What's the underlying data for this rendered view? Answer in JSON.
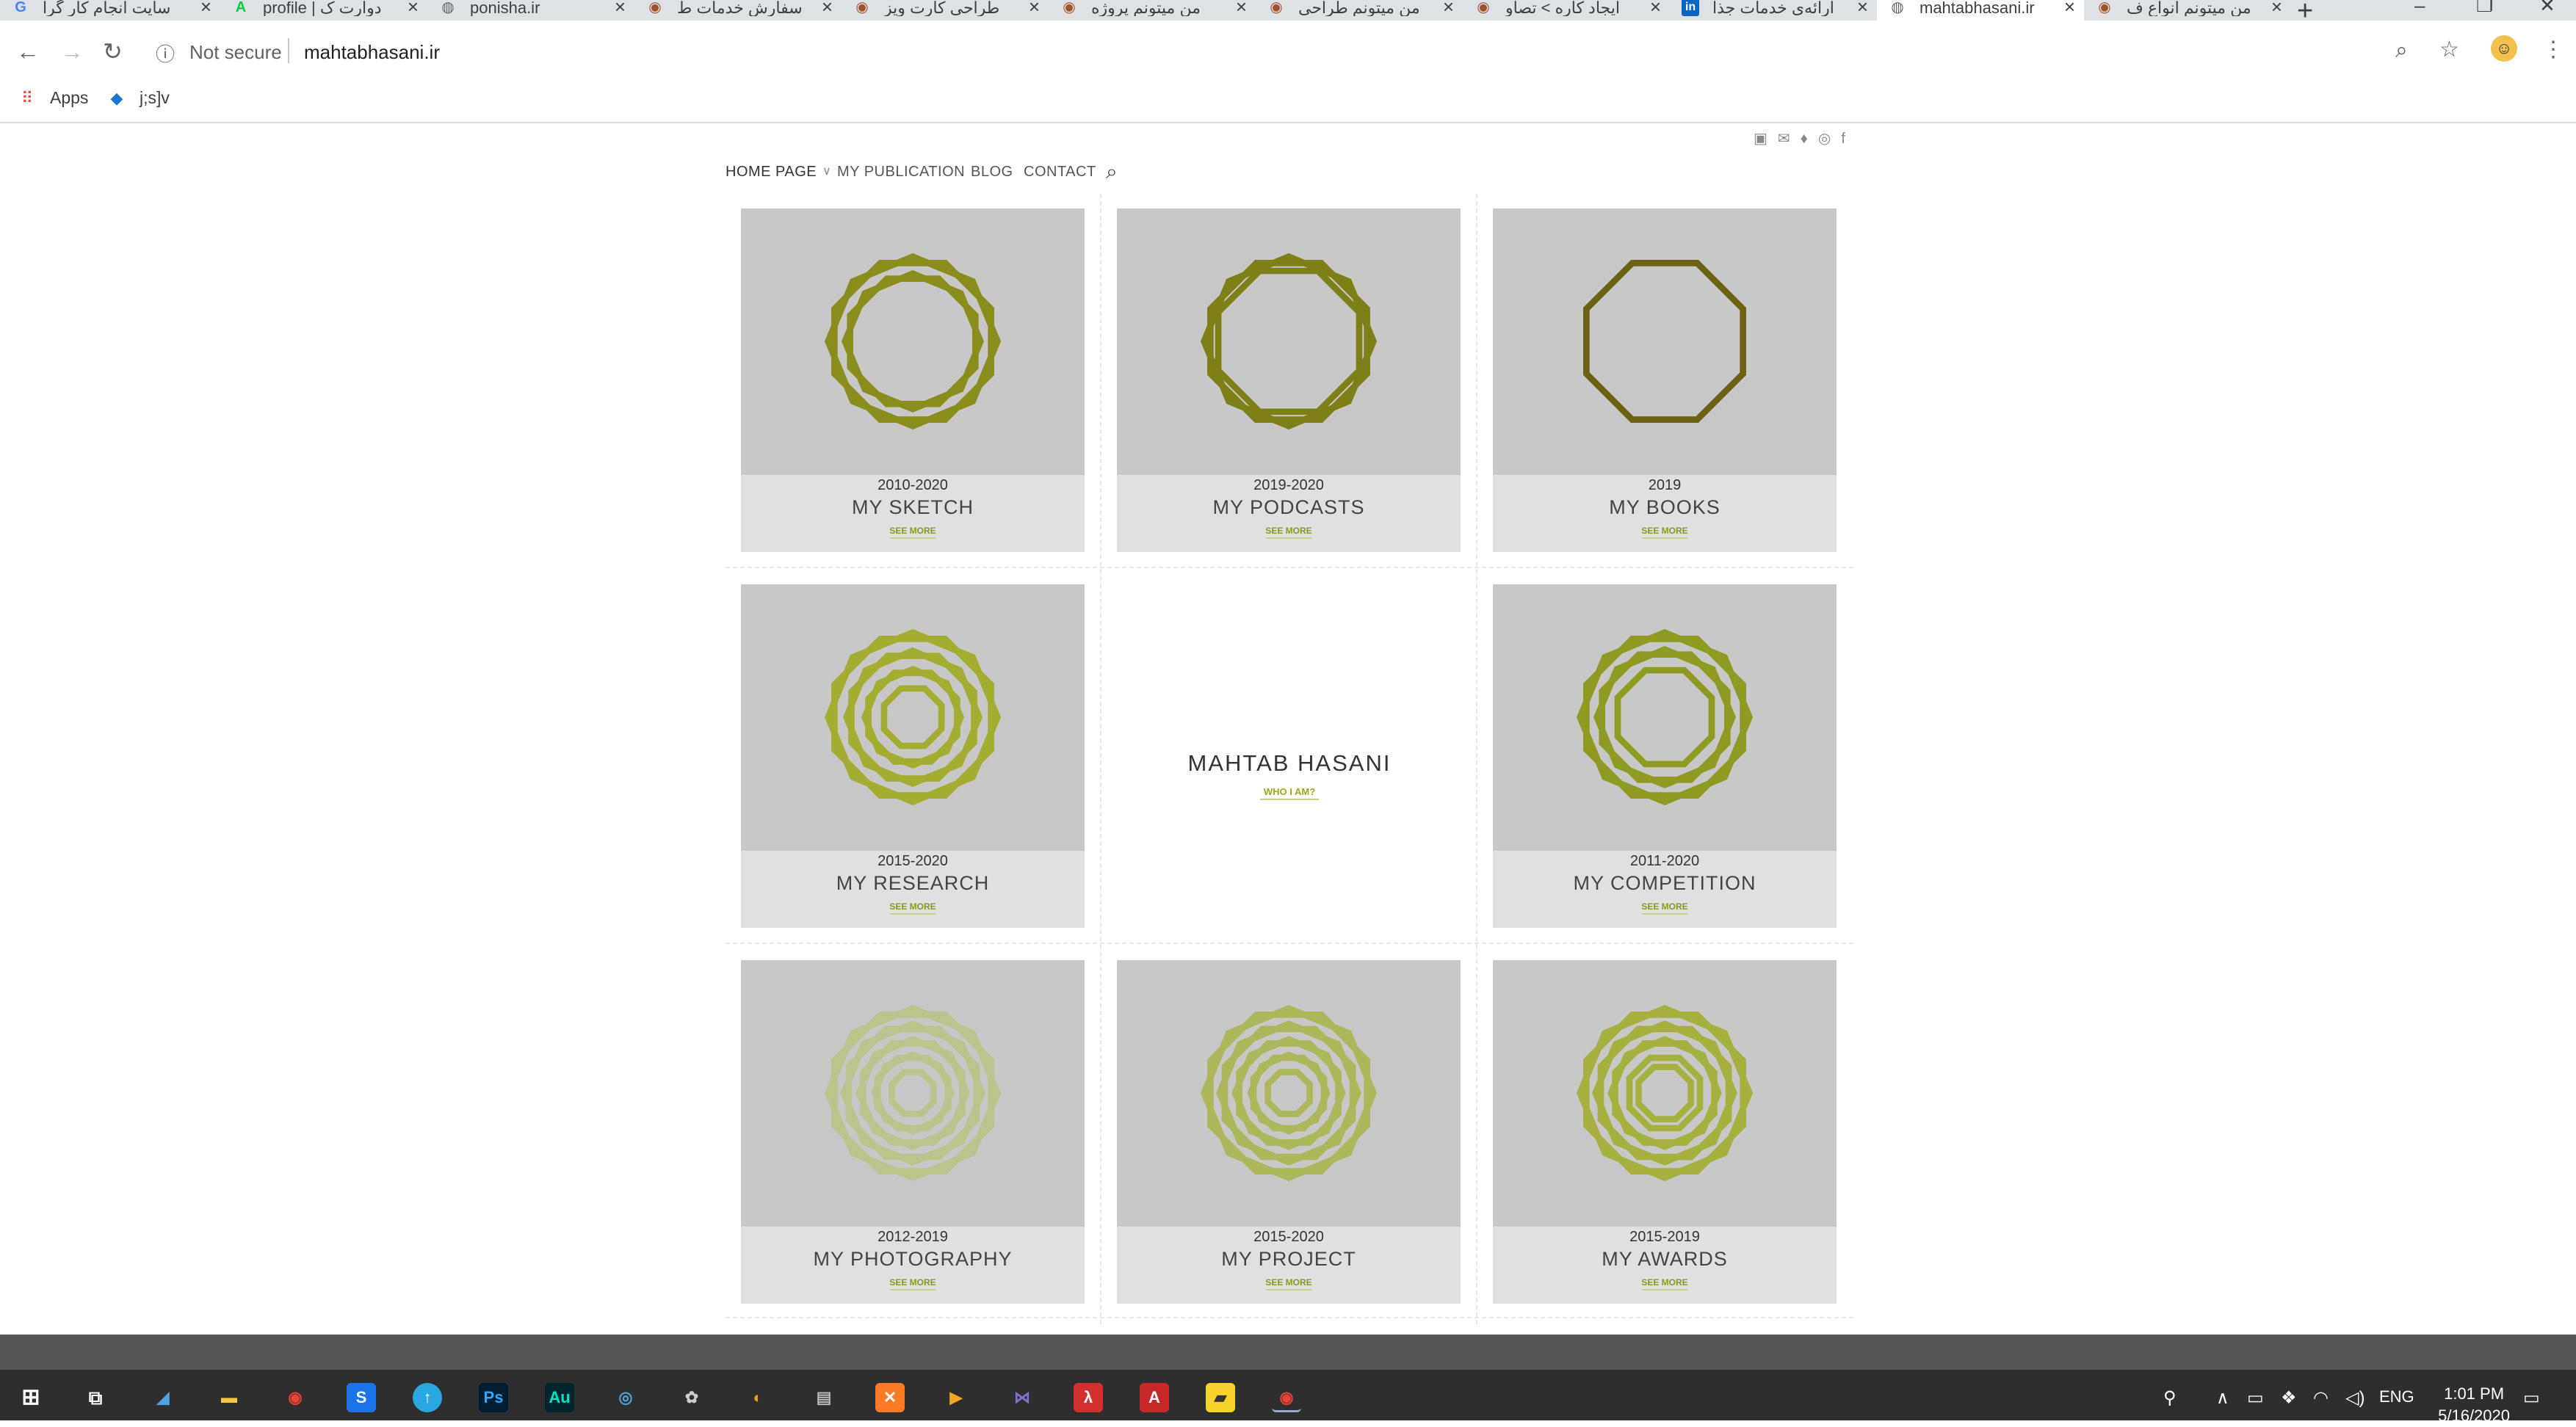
{
  "browser": {
    "tabs": [
      {
        "icon": "google-icon",
        "label": "سایت انجام کار گرا"
      },
      {
        "icon": "deviantart-icon",
        "label": "profile | دوارت ک"
      },
      {
        "icon": "globe-icon",
        "label": "ponisha.ir"
      },
      {
        "icon": "owl-icon",
        "label": "سفارش خدمات ط"
      },
      {
        "icon": "owl-icon",
        "label": "طراحی کارت ویز"
      },
      {
        "icon": "owl-icon",
        "label": "من میتونم پروژه"
      },
      {
        "icon": "owl-icon",
        "label": "من میتونم طراحی"
      },
      {
        "icon": "owl-icon",
        "label": "ایجاد کاره > تصاو"
      },
      {
        "icon": "linkedin-icon",
        "label": "ارائه‌ی خدمات جذا"
      },
      {
        "icon": "globe-icon",
        "label": "mahtabhasani.ir",
        "active": true
      },
      {
        "icon": "owl-icon",
        "label": "من میتونم انواع ف"
      }
    ],
    "security_label": "Not secure",
    "url": "mahtabhasani.ir",
    "bookmarks": [
      {
        "icon": "apps-icon",
        "label": "Apps"
      },
      {
        "icon": "cube-icon",
        "label": "j;s]v"
      }
    ]
  },
  "site": {
    "social_icons": [
      "linkedin-icon",
      "mail-icon",
      "twitter-icon",
      "instagram-icon",
      "facebook-icon"
    ],
    "nav": {
      "home": "HOME PAGE",
      "publication": "MY PUBLICATION",
      "blog": "BLOG",
      "contact": "CONTACT"
    },
    "center": {
      "name": "MAHTAB HASANI",
      "link": "WHO I AM?"
    },
    "cards": [
      {
        "years": "2010-2020",
        "title": "MY SKETCH",
        "more": "SEE MORE",
        "color": "#8a8c1c"
      },
      {
        "years": "2019-2020",
        "title": "MY PODCASTS",
        "more": "SEE MORE",
        "color": "#7f7f18"
      },
      {
        "years": "2019",
        "title": "MY BOOKS",
        "more": "SEE MORE",
        "color": "#6b6214"
      },
      {
        "years": "2015-2020",
        "title": "MY RESEARCH",
        "more": "SEE MORE",
        "color": "#a3ad32"
      },
      {
        "years": "2011-2020",
        "title": "MY COMPETITION",
        "more": "SEE MORE",
        "color": "#8f9a22"
      },
      {
        "years": "2012-2019",
        "title": "MY PHOTOGRAPHY",
        "more": "SEE MORE",
        "color": "#bcc38c"
      },
      {
        "years": "2015-2020",
        "title": "MY PROJECT",
        "more": "SEE MORE",
        "color": "#adb65a"
      },
      {
        "years": "2015-2019",
        "title": "MY AWARDS",
        "more": "SEE MORE",
        "color": "#a6b03e"
      }
    ]
  },
  "taskbar": {
    "language": "ENG",
    "time": "1:01 PM",
    "date": "5/16/2020"
  }
}
